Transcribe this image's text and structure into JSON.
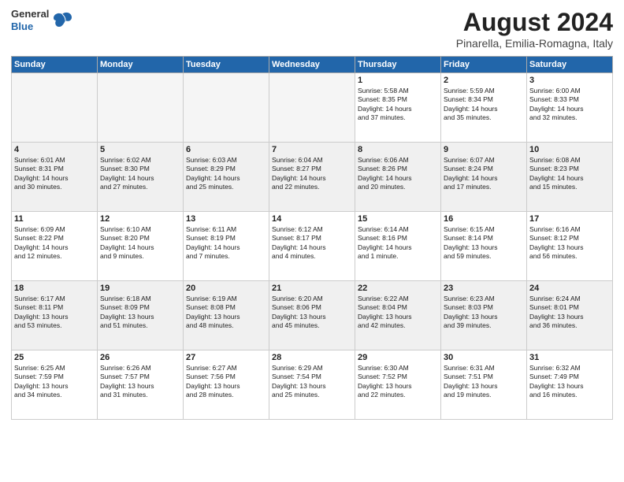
{
  "header": {
    "logo_line1": "General",
    "logo_line2": "Blue",
    "month": "August 2024",
    "location": "Pinarella, Emilia-Romagna, Italy"
  },
  "weekdays": [
    "Sunday",
    "Monday",
    "Tuesday",
    "Wednesday",
    "Thursday",
    "Friday",
    "Saturday"
  ],
  "weeks": [
    [
      {
        "day": "",
        "info": "",
        "empty": true
      },
      {
        "day": "",
        "info": "",
        "empty": true
      },
      {
        "day": "",
        "info": "",
        "empty": true
      },
      {
        "day": "",
        "info": "",
        "empty": true
      },
      {
        "day": "1",
        "info": "Sunrise: 5:58 AM\nSunset: 8:35 PM\nDaylight: 14 hours\nand 37 minutes.",
        "empty": false
      },
      {
        "day": "2",
        "info": "Sunrise: 5:59 AM\nSunset: 8:34 PM\nDaylight: 14 hours\nand 35 minutes.",
        "empty": false
      },
      {
        "day": "3",
        "info": "Sunrise: 6:00 AM\nSunset: 8:33 PM\nDaylight: 14 hours\nand 32 minutes.",
        "empty": false
      }
    ],
    [
      {
        "day": "4",
        "info": "Sunrise: 6:01 AM\nSunset: 8:31 PM\nDaylight: 14 hours\nand 30 minutes.",
        "empty": false
      },
      {
        "day": "5",
        "info": "Sunrise: 6:02 AM\nSunset: 8:30 PM\nDaylight: 14 hours\nand 27 minutes.",
        "empty": false
      },
      {
        "day": "6",
        "info": "Sunrise: 6:03 AM\nSunset: 8:29 PM\nDaylight: 14 hours\nand 25 minutes.",
        "empty": false
      },
      {
        "day": "7",
        "info": "Sunrise: 6:04 AM\nSunset: 8:27 PM\nDaylight: 14 hours\nand 22 minutes.",
        "empty": false
      },
      {
        "day": "8",
        "info": "Sunrise: 6:06 AM\nSunset: 8:26 PM\nDaylight: 14 hours\nand 20 minutes.",
        "empty": false
      },
      {
        "day": "9",
        "info": "Sunrise: 6:07 AM\nSunset: 8:24 PM\nDaylight: 14 hours\nand 17 minutes.",
        "empty": false
      },
      {
        "day": "10",
        "info": "Sunrise: 6:08 AM\nSunset: 8:23 PM\nDaylight: 14 hours\nand 15 minutes.",
        "empty": false
      }
    ],
    [
      {
        "day": "11",
        "info": "Sunrise: 6:09 AM\nSunset: 8:22 PM\nDaylight: 14 hours\nand 12 minutes.",
        "empty": false
      },
      {
        "day": "12",
        "info": "Sunrise: 6:10 AM\nSunset: 8:20 PM\nDaylight: 14 hours\nand 9 minutes.",
        "empty": false
      },
      {
        "day": "13",
        "info": "Sunrise: 6:11 AM\nSunset: 8:19 PM\nDaylight: 14 hours\nand 7 minutes.",
        "empty": false
      },
      {
        "day": "14",
        "info": "Sunrise: 6:12 AM\nSunset: 8:17 PM\nDaylight: 14 hours\nand 4 minutes.",
        "empty": false
      },
      {
        "day": "15",
        "info": "Sunrise: 6:14 AM\nSunset: 8:16 PM\nDaylight: 14 hours\nand 1 minute.",
        "empty": false
      },
      {
        "day": "16",
        "info": "Sunrise: 6:15 AM\nSunset: 8:14 PM\nDaylight: 13 hours\nand 59 minutes.",
        "empty": false
      },
      {
        "day": "17",
        "info": "Sunrise: 6:16 AM\nSunset: 8:12 PM\nDaylight: 13 hours\nand 56 minutes.",
        "empty": false
      }
    ],
    [
      {
        "day": "18",
        "info": "Sunrise: 6:17 AM\nSunset: 8:11 PM\nDaylight: 13 hours\nand 53 minutes.",
        "empty": false
      },
      {
        "day": "19",
        "info": "Sunrise: 6:18 AM\nSunset: 8:09 PM\nDaylight: 13 hours\nand 51 minutes.",
        "empty": false
      },
      {
        "day": "20",
        "info": "Sunrise: 6:19 AM\nSunset: 8:08 PM\nDaylight: 13 hours\nand 48 minutes.",
        "empty": false
      },
      {
        "day": "21",
        "info": "Sunrise: 6:20 AM\nSunset: 8:06 PM\nDaylight: 13 hours\nand 45 minutes.",
        "empty": false
      },
      {
        "day": "22",
        "info": "Sunrise: 6:22 AM\nSunset: 8:04 PM\nDaylight: 13 hours\nand 42 minutes.",
        "empty": false
      },
      {
        "day": "23",
        "info": "Sunrise: 6:23 AM\nSunset: 8:03 PM\nDaylight: 13 hours\nand 39 minutes.",
        "empty": false
      },
      {
        "day": "24",
        "info": "Sunrise: 6:24 AM\nSunset: 8:01 PM\nDaylight: 13 hours\nand 36 minutes.",
        "empty": false
      }
    ],
    [
      {
        "day": "25",
        "info": "Sunrise: 6:25 AM\nSunset: 7:59 PM\nDaylight: 13 hours\nand 34 minutes.",
        "empty": false
      },
      {
        "day": "26",
        "info": "Sunrise: 6:26 AM\nSunset: 7:57 PM\nDaylight: 13 hours\nand 31 minutes.",
        "empty": false
      },
      {
        "day": "27",
        "info": "Sunrise: 6:27 AM\nSunset: 7:56 PM\nDaylight: 13 hours\nand 28 minutes.",
        "empty": false
      },
      {
        "day": "28",
        "info": "Sunrise: 6:29 AM\nSunset: 7:54 PM\nDaylight: 13 hours\nand 25 minutes.",
        "empty": false
      },
      {
        "day": "29",
        "info": "Sunrise: 6:30 AM\nSunset: 7:52 PM\nDaylight: 13 hours\nand 22 minutes.",
        "empty": false
      },
      {
        "day": "30",
        "info": "Sunrise: 6:31 AM\nSunset: 7:51 PM\nDaylight: 13 hours\nand 19 minutes.",
        "empty": false
      },
      {
        "day": "31",
        "info": "Sunrise: 6:32 AM\nSunset: 7:49 PM\nDaylight: 13 hours\nand 16 minutes.",
        "empty": false
      }
    ]
  ]
}
